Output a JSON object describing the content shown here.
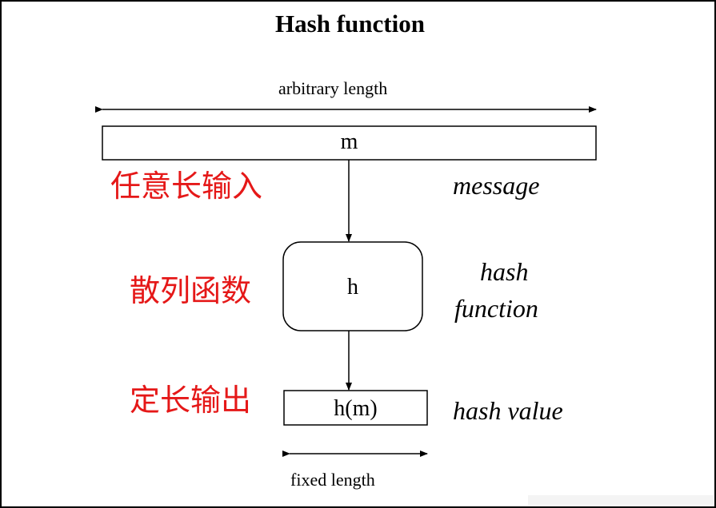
{
  "title": "Hash function",
  "top_span_label": "arbitrary length",
  "bottom_span_label": "fixed length",
  "message_box_text": "m",
  "function_box_text": "h",
  "output_box_text": "h(m)",
  "message_label": "message",
  "function_label_line1": "hash",
  "function_label_line2": "function",
  "output_label": "hash value",
  "annotations": {
    "input": "任意长输入",
    "function": "散列函数",
    "output": "定长输出"
  },
  "colors": {
    "annotation": "#e51818",
    "ink": "#000000",
    "background": "#ffffff"
  }
}
